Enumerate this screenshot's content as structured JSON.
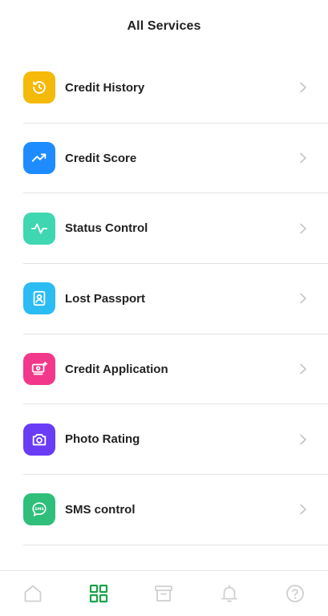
{
  "header": {
    "title": "All Services"
  },
  "services": [
    {
      "label": "Credit History",
      "icon": "history-icon",
      "color": "#f5b90a"
    },
    {
      "label": "Credit Score",
      "icon": "trending-up-icon",
      "color": "#1e8cff"
    },
    {
      "label": "Status Control",
      "icon": "pulse-icon",
      "color": "#3fd6b2"
    },
    {
      "label": "Lost Passport",
      "icon": "id-card-icon",
      "color": "#2bbcf4"
    },
    {
      "label": "Credit Application",
      "icon": "card-add-icon",
      "color": "#f2388a"
    },
    {
      "label": "Photo Rating",
      "icon": "camera-icon",
      "color": "#6a3cf5"
    },
    {
      "label": "SMS control",
      "icon": "sms-icon",
      "color": "#2fbf7a"
    }
  ],
  "bottom_nav": {
    "items": [
      {
        "icon": "home-icon",
        "active": false
      },
      {
        "icon": "grid-icon",
        "active": true
      },
      {
        "icon": "archive-icon",
        "active": false
      },
      {
        "icon": "bell-icon",
        "active": false
      },
      {
        "icon": "help-icon",
        "active": false
      }
    ],
    "active_color": "#1aa34a",
    "inactive_color": "#cfcfcf"
  },
  "colors": {
    "chevron": "#c4c4c4",
    "divider": "#e3e3e3"
  },
  "icon_text": {
    "sms": "SMS"
  }
}
